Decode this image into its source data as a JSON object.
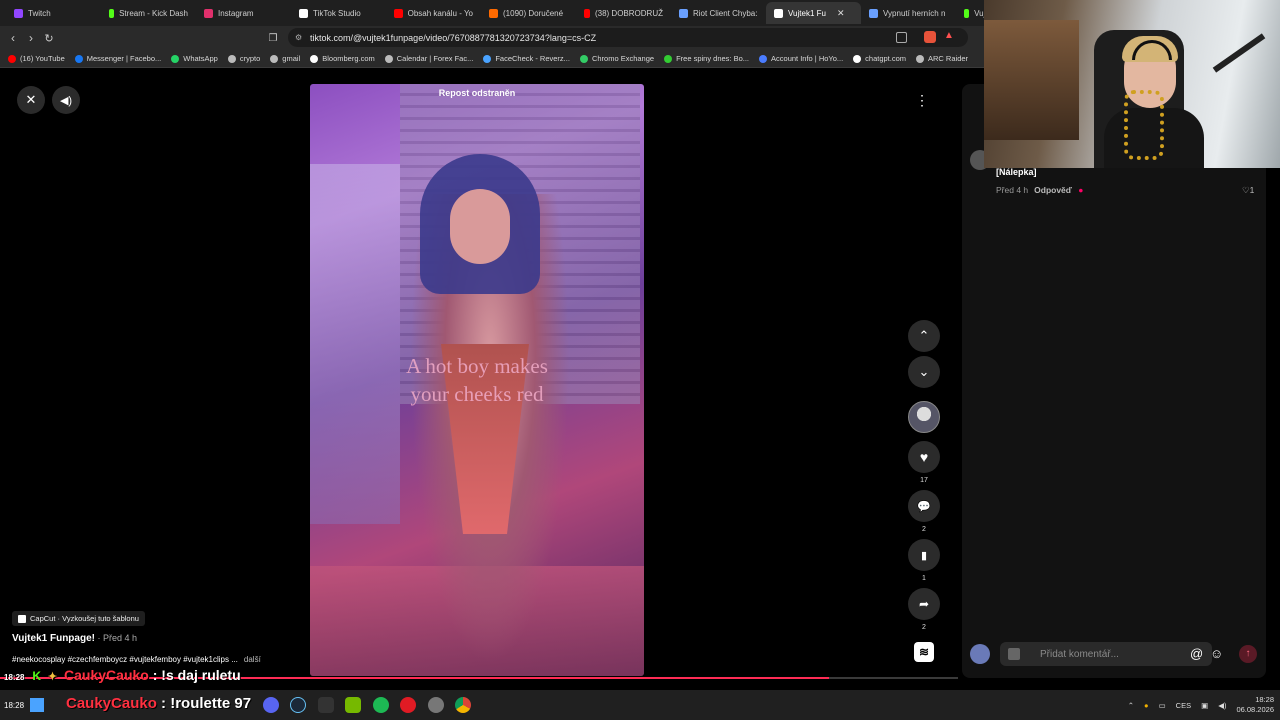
{
  "browser": {
    "tabs": [
      {
        "label": "Twitch",
        "color": "#9146ff"
      },
      {
        "label": "Stream - Kick Dash",
        "color": "#53fc18"
      },
      {
        "label": "Instagram",
        "color": "#e1306c"
      },
      {
        "label": "TikTok Studio",
        "color": "#ffffff"
      },
      {
        "label": "Obsah kanálu - Yo",
        "color": "#ff0000"
      },
      {
        "label": "(1090) Doručené",
        "color": "#ff6a00"
      },
      {
        "label": "(38) DOBRODRUŽ",
        "color": "#ff0000"
      },
      {
        "label": "Riot Client Chyba:",
        "color": "#6aa0ff"
      },
      {
        "label": "Vujtek1 Fu",
        "color": "#ffffff"
      },
      {
        "label": "Vypnutí herních n",
        "color": "#6aa0ff"
      },
      {
        "label": "Vujte",
        "color": "#53fc18"
      }
    ],
    "url": "tiktok.com/@vujtek1funpage/video/7670887781320723734?lang=cs-CZ",
    "bookmarks": [
      {
        "label": "(16) YouTube",
        "color": "#ff0000"
      },
      {
        "label": "Messenger | Facebo...",
        "color": "#1877f2"
      },
      {
        "label": "WhatsApp",
        "color": "#25d366"
      },
      {
        "label": "crypto",
        "color": "#bbbbbb"
      },
      {
        "label": "gmail",
        "color": "#bbbbbb"
      },
      {
        "label": "Bloomberg.com",
        "color": "#ffffff"
      },
      {
        "label": "Calendar | Forex Fac...",
        "color": "#bbbbbb"
      },
      {
        "label": "FaceCheck - Reverz...",
        "color": "#4aa3ff"
      },
      {
        "label": "Chromo Exchange",
        "color": "#33cc66"
      },
      {
        "label": "Free spiny dnes: Bo...",
        "color": "#33cc33"
      },
      {
        "label": "Account Info | HoYo...",
        "color": "#4a7cff"
      },
      {
        "label": "chatgpt.com",
        "color": "#ffffff"
      },
      {
        "label": "ARC Raider",
        "color": "#bbbbbb"
      }
    ]
  },
  "video": {
    "repost_label": "Repost odstraněn",
    "overlay_text_1": "A hot boy makes",
    "overlay_text_2": "your cheeks red",
    "progress": 0.865
  },
  "actions": {
    "likes": "17",
    "comments": "2",
    "saves": "1",
    "shares": "2"
  },
  "post": {
    "capcut_label": "CapCut · Vyzkoušej tuto šablonu",
    "author": "Vujtek1 Funpage!",
    "time": " · Před 4 h",
    "hashtags": "#neekocosplay #czechfemboycz #vujtekfemboy #vujtek1clips ...",
    "more_label": "další"
  },
  "comments": {
    "sticker_label": "[Nálepka]",
    "time": "Před 4 h",
    "reply_label": "Odpověď",
    "like_count": "1",
    "input_placeholder": "Přidat komentář..."
  },
  "chat_overlay": [
    {
      "user": "CaukyCauko",
      "message": " : !s daj ruletu"
    },
    {
      "user": "CaukyCauko",
      "message": " : !roulette 97"
    }
  ],
  "system": {
    "time_left": "18:28",
    "language": "CES",
    "clock_time": "18:28",
    "clock_date": "06.08.2026"
  }
}
